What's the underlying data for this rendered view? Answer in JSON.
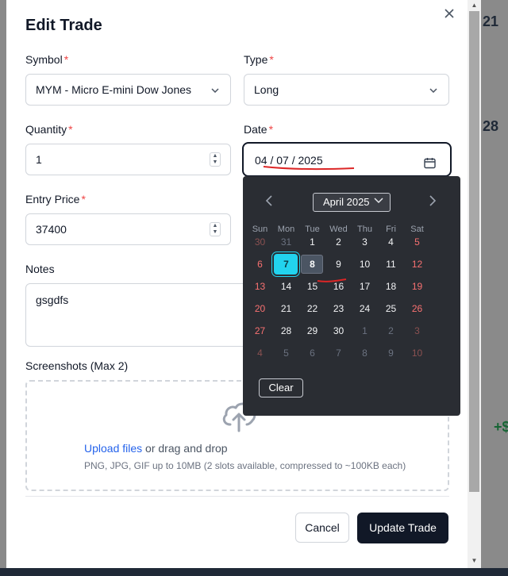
{
  "background": {
    "right_top": "21",
    "right_mid": "28",
    "right_green": "+$"
  },
  "modal": {
    "title": "Edit Trade",
    "symbol": {
      "label": "Symbol",
      "value": "MYM - Micro E-mini Dow Jones"
    },
    "type": {
      "label": "Type",
      "value": "Long"
    },
    "quantity": {
      "label": "Quantity",
      "value": "1"
    },
    "date": {
      "label": "Date",
      "value": "04 / 07 / 2025"
    },
    "entry_price": {
      "label": "Entry Price",
      "value": "37400"
    },
    "notes": {
      "label": "Notes",
      "value": "gsgdfs"
    },
    "screenshots": {
      "label": "Screenshots (Max 2)",
      "upload_link": "Upload files",
      "upload_text": " or drag and drop",
      "hint": "PNG, JPG, GIF up to 10MB (2 slots available, compressed to ~100KB each)"
    },
    "cancel_label": "Cancel",
    "update_label": "Update Trade",
    "required_mark": "*"
  },
  "calendar": {
    "month_label": "April 2025",
    "weekdays": [
      "Sun",
      "Mon",
      "Tue",
      "Wed",
      "Thu",
      "Fri",
      "Sat"
    ],
    "weeks": [
      [
        "30",
        "31",
        "1",
        "2",
        "3",
        "4",
        "5"
      ],
      [
        "6",
        "7",
        "8",
        "9",
        "10",
        "11",
        "12"
      ],
      [
        "13",
        "14",
        "15",
        "16",
        "17",
        "18",
        "19"
      ],
      [
        "20",
        "21",
        "22",
        "23",
        "24",
        "25",
        "26"
      ],
      [
        "27",
        "28",
        "29",
        "30",
        "1",
        "2",
        "3"
      ],
      [
        "4",
        "5",
        "6",
        "7",
        "8",
        "9",
        "10"
      ]
    ],
    "selected_day": "7",
    "today_day": "8",
    "clear_label": "Clear"
  },
  "colors": {
    "accent_selected": "#22d3ee",
    "weekend": "#f87171",
    "primary_button": "#111827",
    "required": "#ef4444",
    "annotation": "#dc2626"
  }
}
